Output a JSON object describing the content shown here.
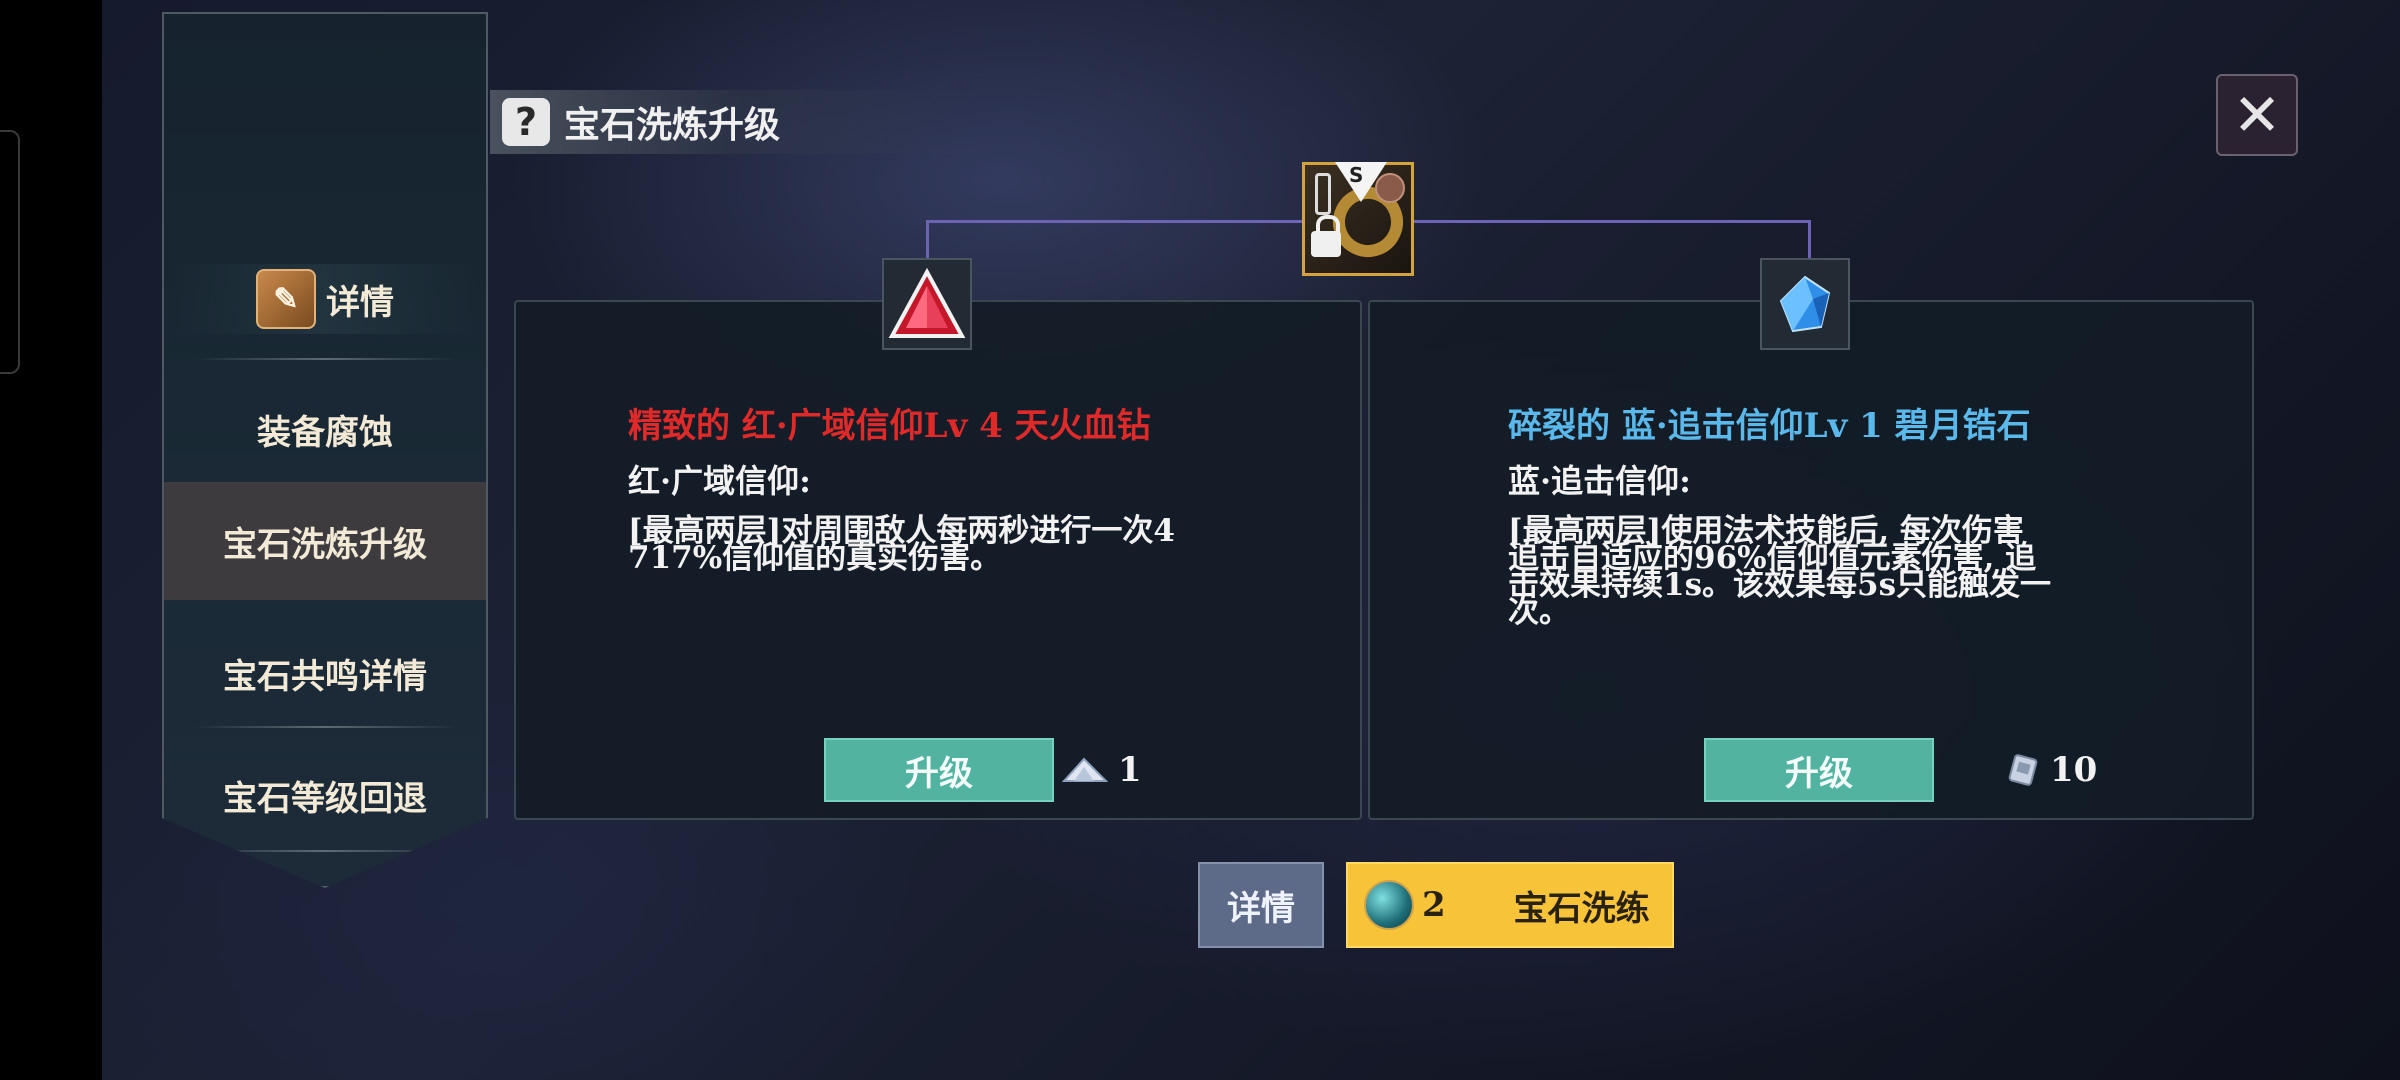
{
  "header": {
    "title": "宝石洗炼升级"
  },
  "sidebar": {
    "detail_label": "详情",
    "items": [
      {
        "label": "装备腐蚀"
      },
      {
        "label": "宝石洗炼升级"
      },
      {
        "label": "宝石共鸣详情"
      },
      {
        "label": "宝石等级回退"
      }
    ]
  },
  "center_item": {
    "badge": "S"
  },
  "left_card": {
    "title": "精致的 红·广域信仰Lv 4 天火血钻",
    "subtitle": "红·广域信仰:",
    "desc_line1": "[最高两层]对周围敌人每两秒进行一次4",
    "desc_line2": "717%信仰值的真实伤害。",
    "button": "升级",
    "cost": "1",
    "title_color": "#e02a2a"
  },
  "right_card": {
    "title": "碎裂的 蓝·追击信仰Lv 1 碧月锆石",
    "subtitle": "蓝·追击信仰:",
    "desc_line1": "[最高两层]使用法术技能后, 每次伤害",
    "desc_line2": "追击自适应的96%信仰值元素伤害, 追",
    "desc_line3": "击效果持续1s。该效果每5s只能触发一",
    "desc_line4": "次。",
    "button": "升级",
    "cost": "10",
    "title_color": "#5ab8ea"
  },
  "bottom": {
    "detail_label": "详情",
    "refine_count": "2",
    "refine_label": "宝石洗练"
  },
  "icons": {
    "close": "close-icon",
    "help": "help-icon",
    "scroll": "scroll-icon",
    "red_gem": "red-gem-icon",
    "blue_gem": "blue-gem-icon",
    "powder": "powder-icon",
    "scroll_material": "scroll-material-icon",
    "orb": "orb-icon"
  }
}
